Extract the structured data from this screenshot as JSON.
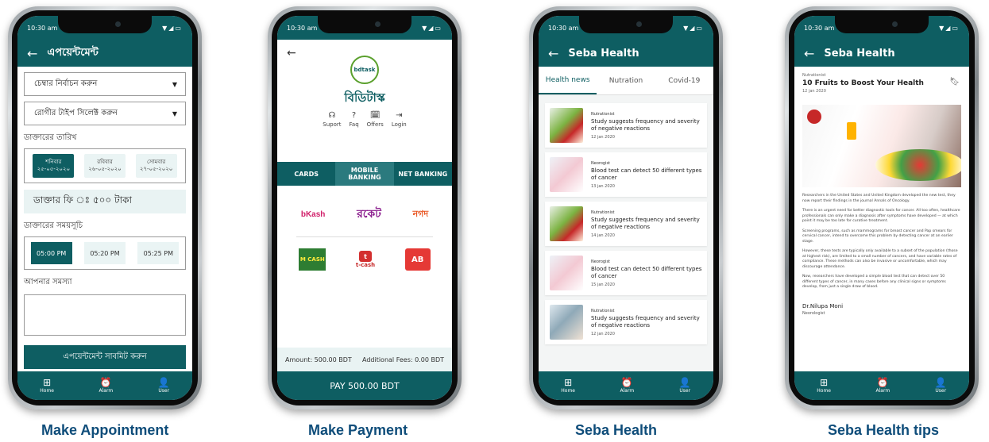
{
  "colors": {
    "primary": "#0e5e62",
    "caption": "#0f4d7a"
  },
  "status_time": "10:30 am",
  "bottom_nav": [
    {
      "icon": "grid-icon",
      "glyph": "⊞",
      "label": "Home"
    },
    {
      "icon": "alarm-icon",
      "glyph": "⏰",
      "label": "Alarm"
    },
    {
      "icon": "user-icon",
      "glyph": "👤",
      "label": "User"
    }
  ],
  "captions": [
    "Make Appointment",
    "Make Payment",
    "Seba Health",
    "Seba Health tips"
  ],
  "appointment": {
    "title": "এপয়েন্টমেন্ট",
    "chamber_select": "চেম্বার নির্বাচন করুন",
    "patient_select": "রোগীর টাইপ সিলেক্ট করুন",
    "date_label": "ডাক্তারের তারিখ",
    "dates": [
      {
        "day": "শনিবার",
        "date": "২৫-০৫-২০২০",
        "active": true
      },
      {
        "day": "রবিবার",
        "date": "২৬-০৫-২০২০",
        "active": false
      },
      {
        "day": "সোমবার",
        "date": "২৭-০৫-২০২০",
        "active": false
      }
    ],
    "fee": "ডাক্তার ফি ঃ ৫০০ টাকা",
    "schedule_label": "ডাক্তারের সময়সূচি",
    "times": [
      "05:00 PM",
      "05:20 PM",
      "05:25 PM"
    ],
    "problem_label": "আপনার সমস্যা",
    "submit": "এপয়েন্টমেন্ট সাবমিট করুন"
  },
  "payment": {
    "logo_text": "bdtask",
    "brand": "বিডিটাস্ক",
    "links": [
      {
        "icon": "headset-icon",
        "glyph": "☊",
        "label": "Suport"
      },
      {
        "icon": "help-icon",
        "glyph": "?",
        "label": "Faq"
      },
      {
        "icon": "offer-icon",
        "glyph": "🗓",
        "label": "Offers"
      },
      {
        "icon": "login-icon",
        "glyph": "⇥",
        "label": "Login"
      }
    ],
    "tabs": [
      "CARDS",
      "MOBILE BANKING",
      "NET BANKING"
    ],
    "providers": {
      "bkash": "bKash",
      "rocket": "রকেট",
      "nagad": "নগদ",
      "mcash": "M CASH",
      "tcash": "t-cash",
      "ab": "AB"
    },
    "amount": "Amount: 500.00 BDT",
    "fees": "Additional Fees: 0.00 BDT",
    "pay_button": "PAY 500.00 BDT"
  },
  "health": {
    "title": "Seba Health",
    "tabs": [
      "Health news",
      "Nutration",
      "Covid-19"
    ],
    "news": [
      {
        "category": "Nutrationist",
        "title": "Study suggests frequency and severity of negative reactions",
        "date": "12 jan 2020",
        "thumb": "food"
      },
      {
        "category": "Neorogist",
        "title": "Blood test can detect 50 different types of cancer",
        "date": "13 jan 2020",
        "thumb": "pregnant"
      },
      {
        "category": "Nutrationist",
        "title": "Study suggests frequency and severity of negative reactions",
        "date": "14 jan 2020",
        "thumb": "food"
      },
      {
        "category": "Neorogist",
        "title": "Blood test can detect 50 different types of cancer",
        "date": "15 jan 2020",
        "thumb": "pregnant"
      },
      {
        "category": "Nutrationist",
        "title": "Study suggests frequency and severity of negative reactions",
        "date": "12 jan 2020",
        "thumb": "eye"
      }
    ]
  },
  "tips": {
    "title": "Seba Health",
    "category": "Nutrationist",
    "article_title": "10 Fruits to Boost Your  Health",
    "date": "12 jan 2020",
    "paragraphs": [
      "Researchers in the United States and United Kingdom developed the new test, they now report their findings in the journal Annals of Oncology.",
      "There is an urgent need for better diagnostic tools for cancer. All too often, healthcare professionals can only make a diagnosis after symptoms have developed — at which point it may be too late for curative treatment.",
      "Screening programs, such as mammograms for breast cancer and Pap smears for cervical cancer, intend to overcome this problem by detecting cancer at an earlier stage.",
      "However, these tests are typically only available to a subset of the population (those at highest risk), are limited to a small number of cancers, and have variable rates of compliance. These methods can also be invasive or uncomfortable, which may discourage attendance.",
      "Now, researchers have developed a simple blood test that can detect over 50 different types of cancer, in many cases before any clinical signs or symptoms develop, from just a single draw of blood."
    ],
    "author_name": "Dr.Nilupa Moni",
    "author_role": "Neorologist"
  }
}
